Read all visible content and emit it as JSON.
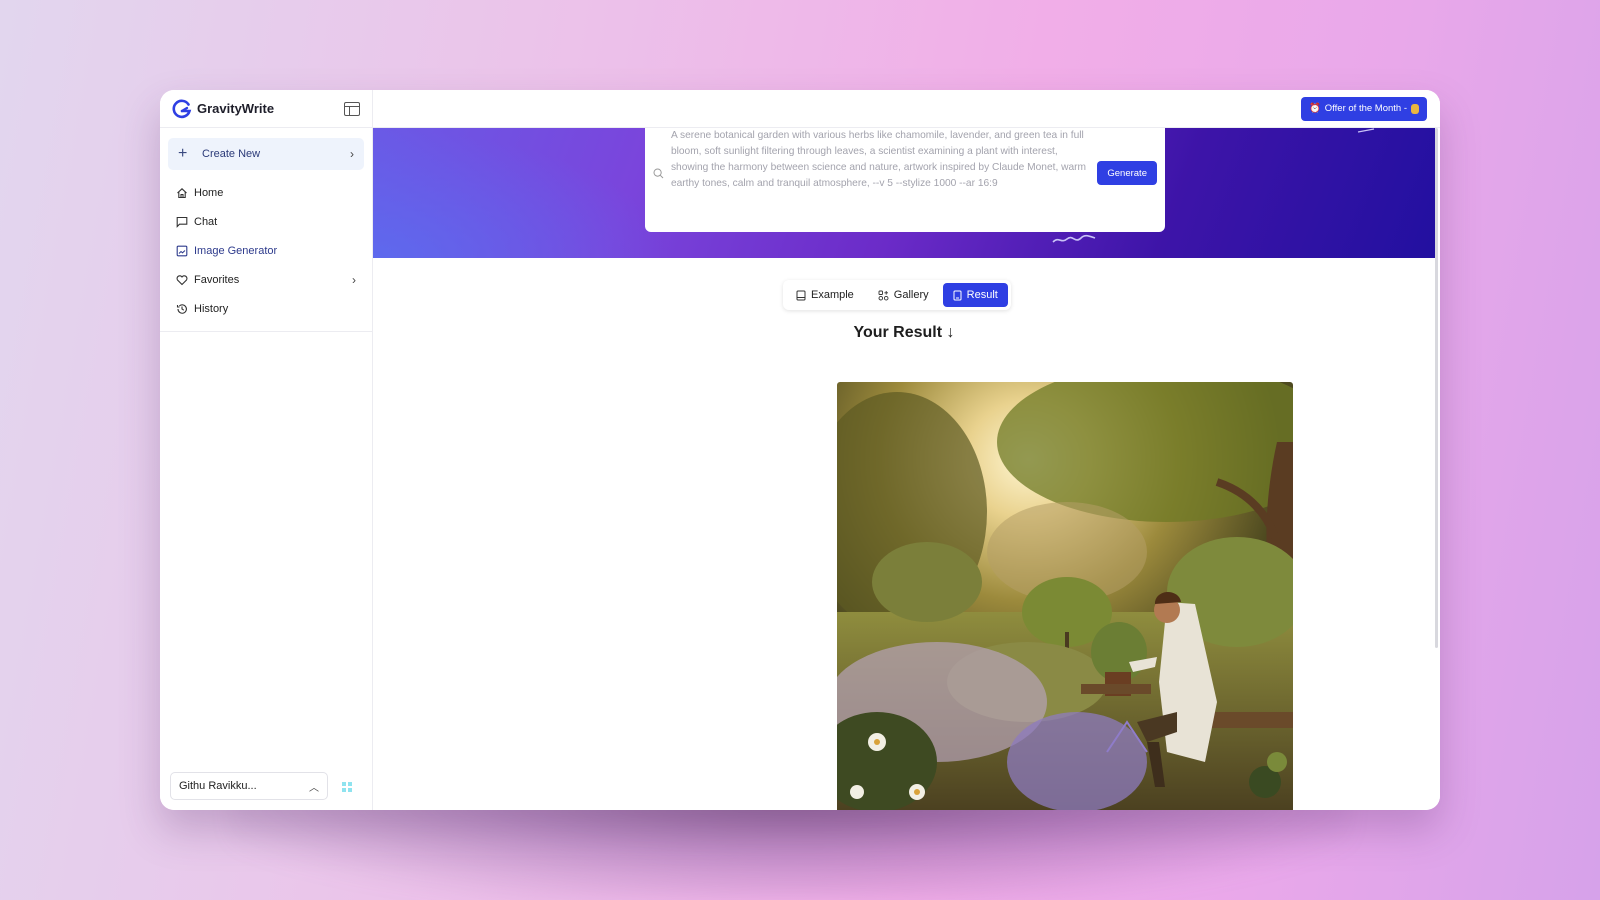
{
  "app": {
    "brand_name": "GravityWrite",
    "accent_color": "#2f3fe3"
  },
  "sidebar": {
    "create_new": {
      "label": "Create New",
      "icon": "plus-icon"
    },
    "items": [
      {
        "label": "Home",
        "icon": "home-icon",
        "active": false
      },
      {
        "label": "Chat",
        "icon": "chat-icon",
        "active": false
      },
      {
        "label": "Image Generator",
        "icon": "image-icon",
        "active": true
      },
      {
        "label": "Favorites",
        "icon": "heart-icon",
        "active": false,
        "has_submenu": true
      },
      {
        "label": "History",
        "icon": "history-icon",
        "active": false
      }
    ],
    "user": {
      "name": "Githu Ravikku..."
    }
  },
  "topbar": {
    "offer_label": "Offer of the Month -",
    "offer_icon": "alarm-clock-icon"
  },
  "prompt": {
    "text": "A serene botanical garden with various herbs like chamomile, lavender, and green tea in full bloom, soft sunlight filtering through leaves, a scientist examining a plant with interest, showing the harmony between science and nature, artwork inspired by Claude Monet, warm earthy tones, calm and tranquil atmosphere, --v 5 --stylize 1000 --ar 16:9",
    "generate_label": "Generate"
  },
  "tabs": [
    {
      "label": "Example",
      "icon": "book-icon",
      "active": false
    },
    {
      "label": "Gallery",
      "icon": "gallery-icon",
      "active": false
    },
    {
      "label": "Result",
      "icon": "document-icon",
      "active": true
    }
  ],
  "result": {
    "heading": "Your Result ↓",
    "image_alt": "Painting of a scientist examining a potted herb in a sunlit botanical garden with lavender and chamomile"
  }
}
